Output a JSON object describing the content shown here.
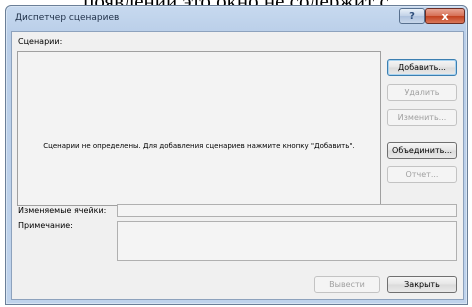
{
  "top_text": "появлении это окно не содержит с",
  "window": {
    "title": "Диспетчер сценариев",
    "help_button": "?",
    "close_button": "x"
  },
  "scenarios": {
    "label": "Сценарии:",
    "empty_message": "Сценарии не определены. Для добавления сценариев нажмите кнопку \"Добавить\"."
  },
  "side_buttons": {
    "add": "Добавить...",
    "delete": "Удалить",
    "edit": "Изменить...",
    "merge": "Объединить...",
    "report": "Отчет..."
  },
  "details": {
    "changing_cells_label": "Изменяемые ячейки:",
    "changing_cells_value": "",
    "comment_label": "Примечание:",
    "comment_value": ""
  },
  "footer": {
    "show": "Вывести",
    "close": "Закрыть"
  }
}
